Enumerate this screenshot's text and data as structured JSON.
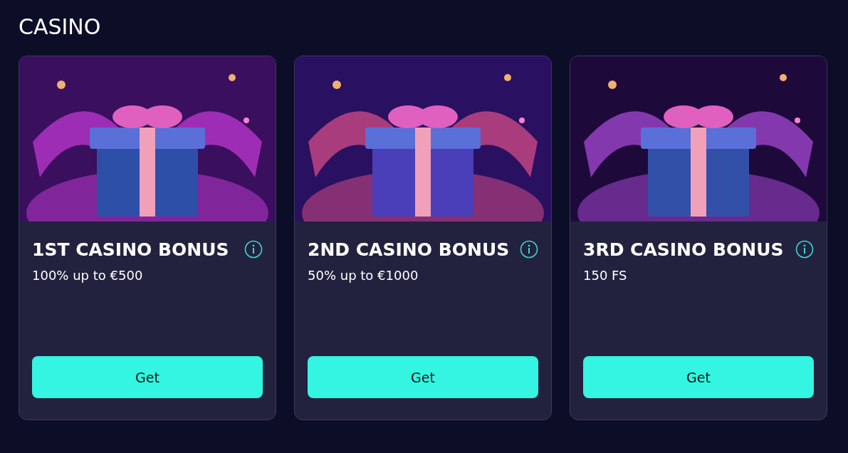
{
  "section": {
    "title": "CASINO"
  },
  "cards": [
    {
      "title": "1ST CASINO BONUS",
      "offer": "100% up to €500",
      "button": "Get"
    },
    {
      "title": "2ND CASINO BONUS",
      "offer": "50% up to €1000",
      "button": "Get"
    },
    {
      "title": "3RD CASINO BONUS",
      "offer": "150 FS",
      "button": "Get"
    }
  ]
}
